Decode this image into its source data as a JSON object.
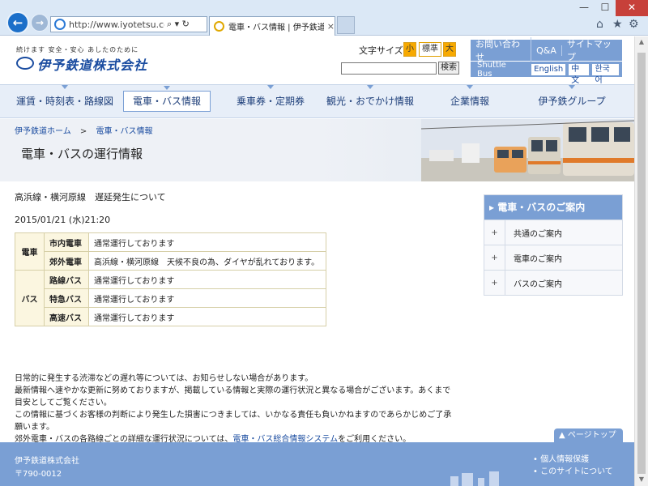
{
  "browser": {
    "url": "http://www.iyotetsu.co.jp/kis",
    "tab_title": "電車・バス情報 | 伊予鉄道",
    "tab_close": "×",
    "back": "←",
    "forward": "→",
    "addr_tools": "⌕ ▾ ↻"
  },
  "header": {
    "tagline": "続けます 安全・安心 あしたのために",
    "logo": "伊予鉄道株式会社",
    "fontsize_label": "文字サイズ",
    "fontsize_small": "小",
    "fontsize_std": "標準",
    "fontsize_large": "大",
    "search_button": "検索",
    "util": [
      "お問い合わせ",
      "Q&A",
      "サイトマップ"
    ],
    "shuttle": "Shuttle Bus",
    "langs": [
      "English",
      "中文",
      "한국어"
    ]
  },
  "gnav": [
    "運賃・時刻表・路線図",
    "電車・バス情報",
    "乗車券・定期券",
    "観光・おでかけ情報",
    "企業情報",
    "伊予鉄グループ"
  ],
  "crumbs": {
    "home": "伊予鉄道ホーム",
    "sep": ">",
    "current": "電車・バス情報"
  },
  "page_title": "電車・バスの運行情報",
  "notice": {
    "title": "高浜線・横河原線　遅延発生について",
    "date": "2015/01/21 (水)21:20"
  },
  "status": {
    "train_cat": "電車",
    "bus_cat": "バス",
    "rows": [
      {
        "line": "市内電車",
        "msg": "通常運行しております"
      },
      {
        "line": "郊外電車",
        "msg": "高浜線・横河原線　天候不良の為、ダイヤが乱れております。"
      },
      {
        "line": "路線バス",
        "msg": "通常運行しております"
      },
      {
        "line": "特急バス",
        "msg": "通常運行しております"
      },
      {
        "line": "高速バス",
        "msg": "通常運行しております"
      }
    ]
  },
  "info": {
    "p1": "日常的に発生する渋滞などの遅れ等については、お知らせしない場合があります。",
    "p2": "最新情報へ速やかな更新に努めておりますが、掲載している情報と実際の運行状況と異なる場合がございます。あくまで目安としてご覧ください。",
    "p3": "この情報に基づくお客様の判断により発生した損害につきましては、いかなる責任も負いかねますのであらかじめご了承願います。",
    "p4_pre": "郊外電車・バスの各路線ごとの詳細な運行状況については、",
    "p4_link": "電車・バス総合情報システム",
    "p4_post": "をご利用ください。"
  },
  "side": {
    "head": "電車・バスのご案内",
    "items": [
      "共通のご案内",
      "電車のご案内",
      "バスのご案内"
    ],
    "plus": "+"
  },
  "pagetop": "ページトップ",
  "footer": {
    "company": "伊予鉄道株式会社",
    "zip": "〒790-0012",
    "links": [
      "個人情報保護",
      "このサイトについて"
    ]
  }
}
